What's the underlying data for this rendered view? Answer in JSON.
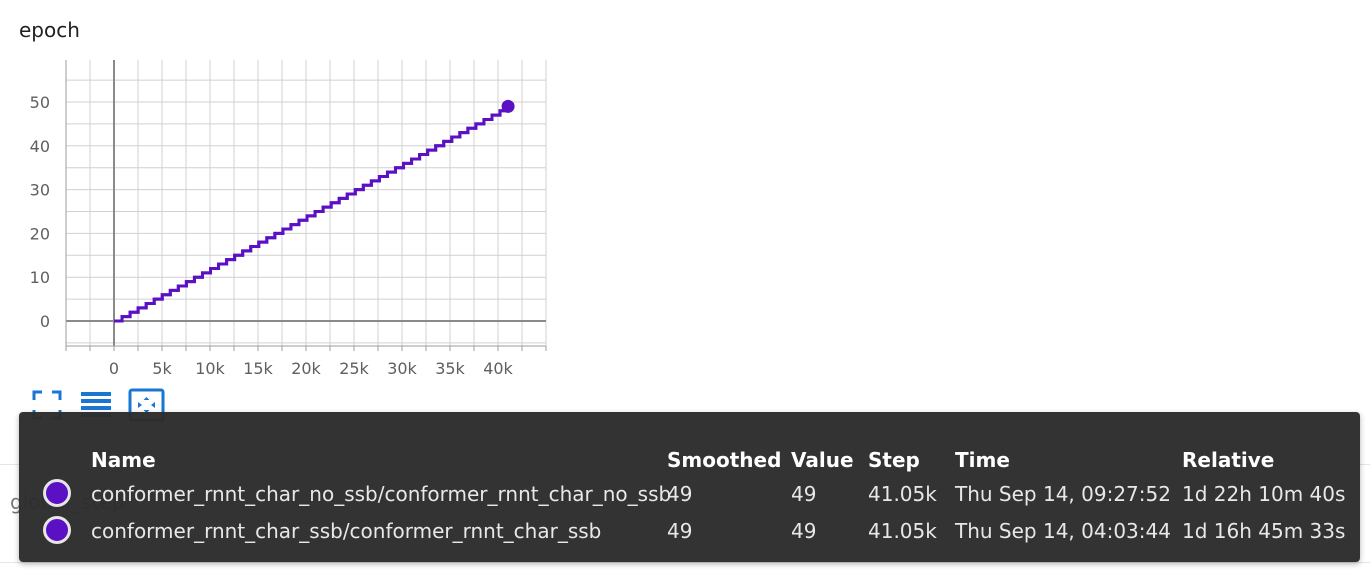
{
  "card": {
    "title": "epoch"
  },
  "chart_data": {
    "type": "line",
    "xlim": [
      0,
      45000
    ],
    "ylim": [
      0,
      59
    ],
    "x_ticks": [
      0,
      5000,
      10000,
      15000,
      20000,
      25000,
      30000,
      35000,
      40000
    ],
    "x_tick_labels": [
      "0",
      "5k",
      "10k",
      "15k",
      "20k",
      "25k",
      "30k",
      "35k",
      "40k"
    ],
    "y_ticks": [
      0,
      10,
      20,
      30,
      40,
      50
    ],
    "y_tick_labels": [
      "0",
      "10",
      "20",
      "30",
      "40",
      "50"
    ],
    "grid": true,
    "series_color": "#5c10c4",
    "series": [
      {
        "name": "conformer_rnnt_char_no_ssb/conformer_rnnt_char_no_ssb",
        "step_size": 837.755,
        "max_epoch": 49,
        "last_step": 41050
      },
      {
        "name": "conformer_rnnt_char_ssb/conformer_rnnt_char_ssb",
        "step_size": 837.755,
        "max_epoch": 49,
        "last_step": 41050
      }
    ]
  },
  "toolbar": {
    "icons": [
      "fullscreen-icon",
      "data-table-icon",
      "fit-domain-icon"
    ],
    "accent": "#1976d2"
  },
  "below": {
    "label": "global_step"
  },
  "tooltip": {
    "headers": {
      "name": "Name",
      "smoothed": "Smoothed",
      "value": "Value",
      "step": "Step",
      "time": "Time",
      "relative": "Relative"
    },
    "rows": [
      {
        "color": "#5c10c4",
        "name": "conformer_rnnt_char_no_ssb/conformer_rnnt_char_no_ssb",
        "smoothed": "49",
        "value": "49",
        "step": "41.05k",
        "time": "Thu Sep 14, 09:27:52",
        "relative": "1d 22h 10m 40s"
      },
      {
        "color": "#5c10c4",
        "name": "conformer_rnnt_char_ssb/conformer_rnnt_char_ssb",
        "smoothed": "49",
        "value": "49",
        "step": "41.05k",
        "time": "Thu Sep 14, 04:03:44",
        "relative": "1d 16h 45m 33s"
      }
    ]
  }
}
